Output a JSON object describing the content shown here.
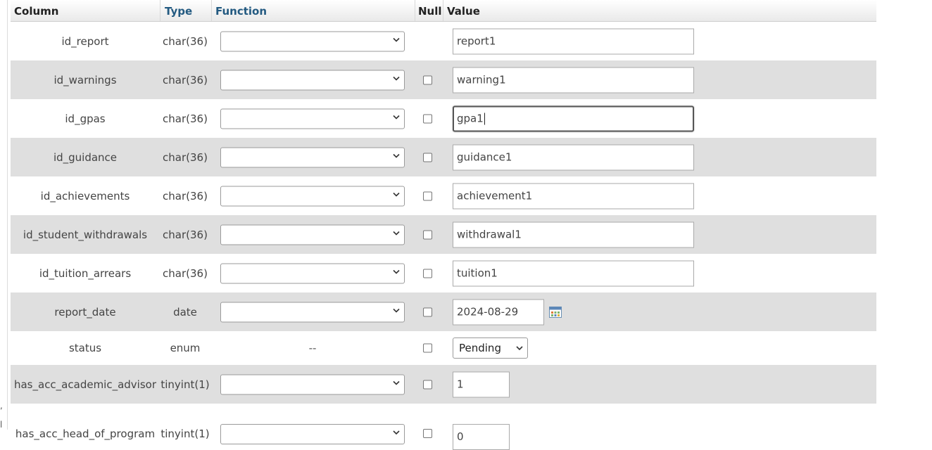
{
  "header": {
    "column": "Column",
    "type": "Type",
    "function": "Function",
    "null": "Null",
    "value": "Value"
  },
  "rows": [
    {
      "column": "id_report",
      "type": "char(36)",
      "value": "report1"
    },
    {
      "column": "id_warnings",
      "type": "char(36)",
      "value": "warning1"
    },
    {
      "column": "id_gpas",
      "type": "char(36)",
      "value": "gpa1"
    },
    {
      "column": "id_guidance",
      "type": "char(36)",
      "value": "guidance1"
    },
    {
      "column": "id_achievements",
      "type": "char(36)",
      "value": "achievement1"
    },
    {
      "column": "id_student_withdrawals",
      "type": "char(36)",
      "value": "withdrawal1"
    },
    {
      "column": "id_tuition_arrears",
      "type": "char(36)",
      "value": "tuition1"
    },
    {
      "column": "report_date",
      "type": "date",
      "value": "2024-08-29"
    },
    {
      "column": "status",
      "type": "enum",
      "function": "--",
      "value": "Pending"
    },
    {
      "column": "has_acc_academic_advisor",
      "type": "tinyint(1)",
      "value": "1"
    },
    {
      "column": "has_acc_head_of_program",
      "type": "tinyint(1)",
      "value": "0"
    }
  ],
  "edge_marks": [
    ",",
    "l"
  ],
  "icons": {
    "dropdown": "chevron-down-icon",
    "calendar": "calendar-icon"
  },
  "colors": {
    "header_link": "#235a81",
    "row_alt": "#dfdfdf"
  }
}
